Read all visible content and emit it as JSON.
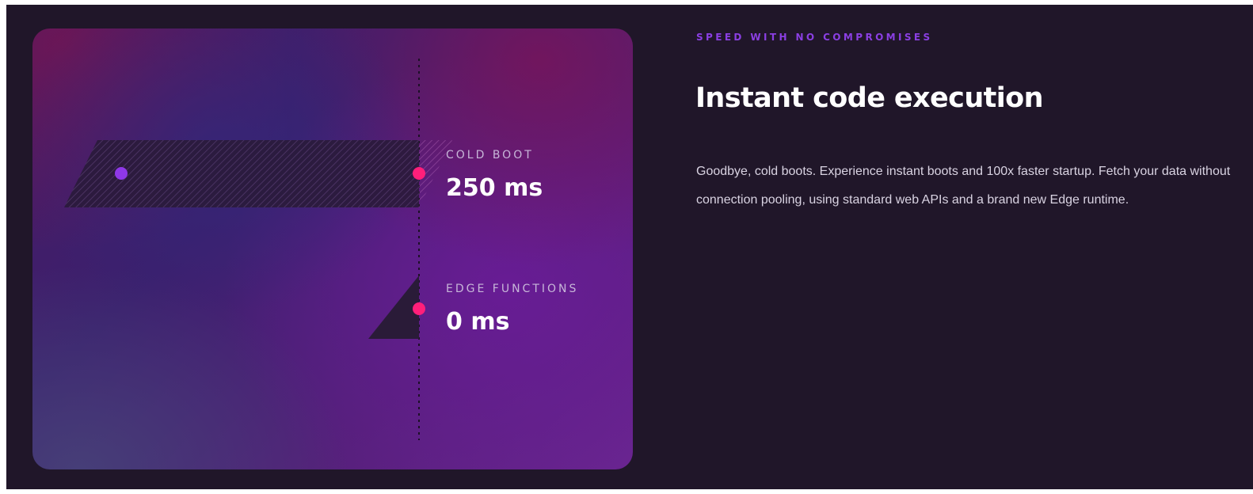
{
  "colors": {
    "page_background": "#201629",
    "eyebrow": "#8b3fe3",
    "accent_pink": "#ff2b78",
    "accent_purple": "#8f38e8",
    "headline": "#ffffff",
    "body_text": "#d9d3e2"
  },
  "visual": {
    "cold_boot": {
      "label": "COLD BOOT",
      "value": "250 ms"
    },
    "edge_functions": {
      "label": "EDGE FUNCTIONS",
      "value": "0 ms"
    }
  },
  "copy": {
    "eyebrow": "SPEED WITH NO COMPROMISES",
    "headline": "Instant code execution",
    "body": "Goodbye, cold boots. Experience instant boots and 100x faster startup. Fetch your data without connection pooling, using standard web APIs and a brand new Edge runtime."
  }
}
